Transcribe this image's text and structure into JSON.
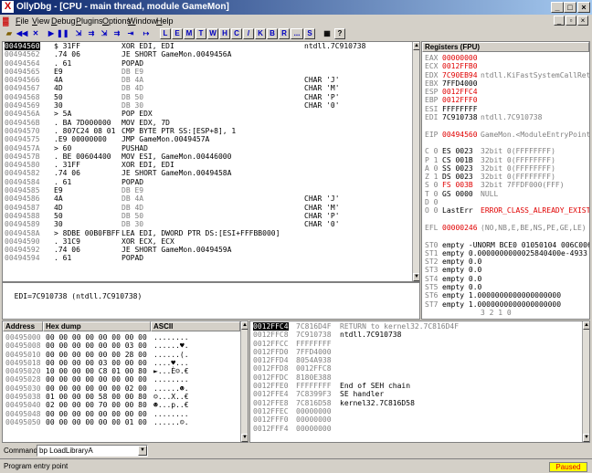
{
  "title": "OllyDbg - [CPU - main thread, module GameMon]",
  "title_icon": "X",
  "menu": [
    "File",
    "View",
    "Debug",
    "Plugins",
    "Options",
    "Window",
    "Help"
  ],
  "toolbar": {
    "icons": [
      "open-icon",
      "rewind-icon",
      "close-icon",
      "play-icon",
      "pause-icon",
      "step-into-icon",
      "step-over-icon",
      "trace-into-icon",
      "trace-over-icon",
      "execute-till-return-icon",
      "goto-icon"
    ],
    "letters": [
      "L",
      "E",
      "M",
      "T",
      "W",
      "H",
      "C",
      "/",
      "K",
      "B",
      "R",
      "...",
      "S"
    ],
    "help": "?"
  },
  "disasm": {
    "rows": [
      {
        "addr": "00494560",
        "hex": "$ 31FF",
        "instr": "XOR EDI, EDI",
        "comment": "ntdll.7C910738",
        "selected": true
      },
      {
        "addr": "00494562",
        "hex": ".74 06",
        "instr": "JE SHORT GameMon.0049456A",
        "comment": ""
      },
      {
        "addr": "00494564",
        "hex": ". 61",
        "instr": "POPAD",
        "comment": ""
      },
      {
        "addr": "00494565",
        "hex": "E9",
        "instr": "DB E9",
        "comment": "",
        "gray": true
      },
      {
        "addr": "00494566",
        "hex": "4A",
        "instr": "DB 4A",
        "comment": "CHAR 'J'",
        "gray": true
      },
      {
        "addr": "00494567",
        "hex": "4D",
        "instr": "DB 4D",
        "comment": "CHAR 'M'",
        "gray": true
      },
      {
        "addr": "00494568",
        "hex": "50",
        "instr": "DB 50",
        "comment": "CHAR 'P'",
        "gray": true
      },
      {
        "addr": "00494569",
        "hex": "30",
        "instr": "DB 30",
        "comment": "CHAR '0'",
        "gray": true
      },
      {
        "addr": "0049456A",
        "hex": "> 5A",
        "instr": "POP EDX",
        "comment": ""
      },
      {
        "addr": "0049456B",
        "hex": ". BA 7D000000",
        "instr": "MOV EDX, 7D",
        "comment": ""
      },
      {
        "addr": "00494570",
        "hex": ". 807C24 08 01",
        "instr": "CMP BYTE PTR SS:[ESP+8], 1",
        "comment": ""
      },
      {
        "addr": "00494575",
        "hex": ".E9 00000000",
        "instr": "JMP GameMon.0049457A",
        "comment": ""
      },
      {
        "addr": "0049457A",
        "hex": "> 60",
        "instr": "PUSHAD",
        "comment": ""
      },
      {
        "addr": "0049457B",
        "hex": ". BE 00604400",
        "instr": "MOV ESI, GameMon.00446000",
        "comment": ""
      },
      {
        "addr": "00494580",
        "hex": ". 31FF",
        "instr": "XOR EDI, EDI",
        "comment": ""
      },
      {
        "addr": "00494582",
        "hex": ".74 06",
        "instr": "JE SHORT GameMon.0049458A",
        "comment": ""
      },
      {
        "addr": "00494584",
        "hex": ". 61",
        "instr": "POPAD",
        "comment": ""
      },
      {
        "addr": "00494585",
        "hex": "E9",
        "instr": "DB E9",
        "comment": "",
        "gray": true
      },
      {
        "addr": "00494586",
        "hex": "4A",
        "instr": "DB 4A",
        "comment": "CHAR 'J'",
        "gray": true
      },
      {
        "addr": "00494587",
        "hex": "4D",
        "instr": "DB 4D",
        "comment": "CHAR 'M'",
        "gray": true
      },
      {
        "addr": "00494588",
        "hex": "50",
        "instr": "DB 50",
        "comment": "CHAR 'P'",
        "gray": true
      },
      {
        "addr": "00494589",
        "hex": "30",
        "instr": "DB 30",
        "comment": "CHAR '0'",
        "gray": true
      },
      {
        "addr": "0049458A",
        "hex": "> 8DBE 00B0FBFF",
        "instr": "LEA EDI, DWORD PTR DS:[ESI+FFFBB000]",
        "comment": ""
      },
      {
        "addr": "00494590",
        "hex": ". 31C9",
        "instr": "XOR ECX, ECX",
        "comment": ""
      },
      {
        "addr": "00494592",
        "hex": ".74 06",
        "instr": "JE SHORT GameMon.0049459A",
        "comment": ""
      },
      {
        "addr": "00494594",
        "hex": ". 61",
        "instr": "POPAD",
        "comment": ""
      }
    ],
    "info": "EDI=7C910738 (ntdll.7C910738)"
  },
  "registers": {
    "header": "Registers (FPU)",
    "rows": [
      {
        "name": "EAX",
        "value": "00000000",
        "comment": "",
        "red": true
      },
      {
        "name": "ECX",
        "value": "0012FFB0",
        "comment": "",
        "red": true
      },
      {
        "name": "EDX",
        "value": "7C90EB94",
        "comment": "ntdll.KiFastSystemCallRet",
        "red": true
      },
      {
        "name": "EBX",
        "value": "7FFD4000",
        "comment": ""
      },
      {
        "name": "ESP",
        "value": "0012FFC4",
        "comment": "",
        "red": true
      },
      {
        "name": "EBP",
        "value": "0012FFF0",
        "comment": "",
        "red": true
      },
      {
        "name": "ESI",
        "value": "FFFFFFFF",
        "comment": ""
      },
      {
        "name": "EDI",
        "value": "7C910738",
        "comment": "ntdll.7C910738"
      },
      {
        "name": "",
        "value": "",
        "comment": ""
      },
      {
        "name": "EIP",
        "value": "00494560",
        "comment": "GameMon.<ModuleEntryPoint>",
        "red": true
      },
      {
        "name": "",
        "value": "",
        "comment": ""
      },
      {
        "name": "C 0",
        "value": "ES 0023",
        "comment": "32bit 0(FFFFFFFF)"
      },
      {
        "name": "P 1",
        "value": "CS 001B",
        "comment": "32bit 0(FFFFFFFF)"
      },
      {
        "name": "A 0",
        "value": "SS 0023",
        "comment": "32bit 0(FFFFFFFF)"
      },
      {
        "name": "Z 1",
        "value": "DS 0023",
        "comment": "32bit 0(FFFFFFFF)"
      },
      {
        "name": "S 0",
        "value": "FS 003B",
        "comment": "32bit 7FFDF000(FFF)",
        "red": true
      },
      {
        "name": "T 0",
        "value": "GS 0000",
        "comment": "NULL"
      },
      {
        "name": "D 0",
        "value": "",
        "comment": ""
      },
      {
        "name": "O 0",
        "value": "LastErr",
        "comment": "ERROR_CLASS_ALREADY_EXISTS",
        "redc": true
      },
      {
        "name": "",
        "value": "",
        "comment": ""
      },
      {
        "name": "EFL",
        "value": "00000246",
        "comment": "(NO,NB,E,BE,NS,PE,GE,LE)",
        "red": true
      },
      {
        "name": "",
        "value": "",
        "comment": ""
      },
      {
        "name": "ST0",
        "value": "empty -UNORM BCE0 01050104 006C006F",
        "comment": ""
      },
      {
        "name": "ST1",
        "value": "empty 0.0000000000025840400e-4933",
        "comment": ""
      },
      {
        "name": "ST2",
        "value": "empty 0.0",
        "comment": ""
      },
      {
        "name": "ST3",
        "value": "empty 0.0",
        "comment": ""
      },
      {
        "name": "ST4",
        "value": "empty 0.0",
        "comment": ""
      },
      {
        "name": "ST5",
        "value": "empty 0.0",
        "comment": ""
      },
      {
        "name": "ST6",
        "value": "empty 1.0000000000000000000",
        "comment": "",
        "redc": true
      },
      {
        "name": "ST7",
        "value": "empty 1.0000000000000000000",
        "comment": "",
        "redc": true
      },
      {
        "name": "",
        "value": "",
        "comment": "3 2 1 0"
      }
    ]
  },
  "dump": {
    "headers": [
      "Address",
      "Hex dump",
      "ASCII"
    ],
    "rows": [
      {
        "addr": "00495000",
        "hex": "00 00 00 00 00 00 00 00",
        "ascii": "........"
      },
      {
        "addr": "00495008",
        "hex": "00 00 00 00 00 00 03 00",
        "ascii": "......♥."
      },
      {
        "addr": "00495010",
        "hex": "00 00 00 00 00 00 28 00",
        "ascii": "......(."
      },
      {
        "addr": "00495018",
        "hex": "00 00 00 00 03 00 00 00",
        "ascii": "....♥..."
      },
      {
        "addr": "00495020",
        "hex": "10 00 00 00 C8 01 00 80",
        "ascii": "►...È☺.€"
      },
      {
        "addr": "00495028",
        "hex": "00 00 00 00 00 00 00 00",
        "ascii": "........"
      },
      {
        "addr": "00495030",
        "hex": "00 00 00 00 00 00 02 00",
        "ascii": "......☻."
      },
      {
        "addr": "00495038",
        "hex": "01 00 00 00 58 00 00 80",
        "ascii": "☺...X..€"
      },
      {
        "addr": "00495040",
        "hex": "02 00 00 00 70 00 00 80",
        "ascii": "☻...p..€"
      },
      {
        "addr": "00495048",
        "hex": "00 00 00 00 00 00 00 00",
        "ascii": "........"
      },
      {
        "addr": "00495050",
        "hex": "00 00 00 00 00 00 01 00",
        "ascii": "......☺."
      }
    ]
  },
  "stack": {
    "rows": [
      {
        "addr": "0012FFC4",
        "value": "7C816D4F",
        "comment": "RETURN to kernel32.7C816D4F",
        "selected": true
      },
      {
        "addr": "0012FFC8",
        "value": "7C910738",
        "comment": "ntdll.7C910738"
      },
      {
        "addr": "0012FFCC",
        "value": "FFFFFFFF",
        "comment": ""
      },
      {
        "addr": "0012FFD0",
        "value": "7FFD4000",
        "comment": ""
      },
      {
        "addr": "0012FFD4",
        "value": "8054A938",
        "comment": ""
      },
      {
        "addr": "0012FFD8",
        "value": "0012FFC8",
        "comment": ""
      },
      {
        "addr": "0012FFDC",
        "value": "8180E388",
        "comment": ""
      },
      {
        "addr": "0012FFE0",
        "value": "FFFFFFFF",
        "comment": "End of SEH chain"
      },
      {
        "addr": "0012FFE4",
        "value": "7C8399F3",
        "comment": "SE handler"
      },
      {
        "addr": "0012FFE8",
        "value": "7C816D58",
        "comment": "kernel32.7C816D58"
      },
      {
        "addr": "0012FFEC",
        "value": "00000000",
        "comment": ""
      },
      {
        "addr": "0012FFF0",
        "value": "00000000",
        "comment": ""
      },
      {
        "addr": "0012FFF4",
        "value": "00000000",
        "comment": ""
      }
    ]
  },
  "command": {
    "label": "Command",
    "value": "bp LoadLibraryA"
  },
  "status": {
    "left": "Program entry point",
    "right": "Paused"
  }
}
